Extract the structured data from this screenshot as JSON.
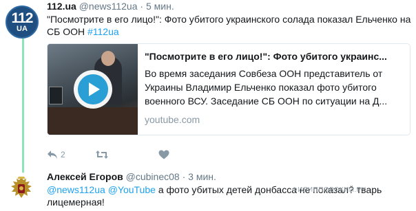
{
  "tweet1": {
    "avatar": {
      "number": "112",
      "country": "UA"
    },
    "name": "112.ua",
    "handle": "@news112ua",
    "separator": "·",
    "time": "5 мин.",
    "text": "\"Посмотрите в его лицо!\": Фото убитого украинского солада показал Ельченко на СБ ООН",
    "hashtag": "#112ua",
    "card": {
      "title": "\"Посмотрите в его лицо!\": Фото убитого украинс...",
      "description": "Во время заседания Совбеза ООН представитель от Украины Владимир Ельченко показал фото убитого военного ВСУ. Заседание СБ ООН по ситуации на Д...",
      "domain": "youtube.com"
    },
    "actions": {
      "reply_count": "2"
    }
  },
  "tweet2": {
    "name": "Алексей Егоров",
    "handle": "@cubinec08",
    "separator": "·",
    "time": "3 мин.",
    "mention1": "@news112ua",
    "mention2": "@YouTube",
    "text": "а фото убитых детей донбасса не показал? тварь лицемерная!"
  },
  "watermark": "ФИЛИППОВСКИЙ.РУ",
  "colors": {
    "link": "#1da1f2",
    "thread_line": "#8ee3b8",
    "muted": "#657786",
    "icon": "#8899a6",
    "play": "#2a9fd6"
  },
  "icons": [
    "reply-icon",
    "retweet-icon",
    "like-icon",
    "play-icon",
    "coat-of-arms-icon"
  ]
}
